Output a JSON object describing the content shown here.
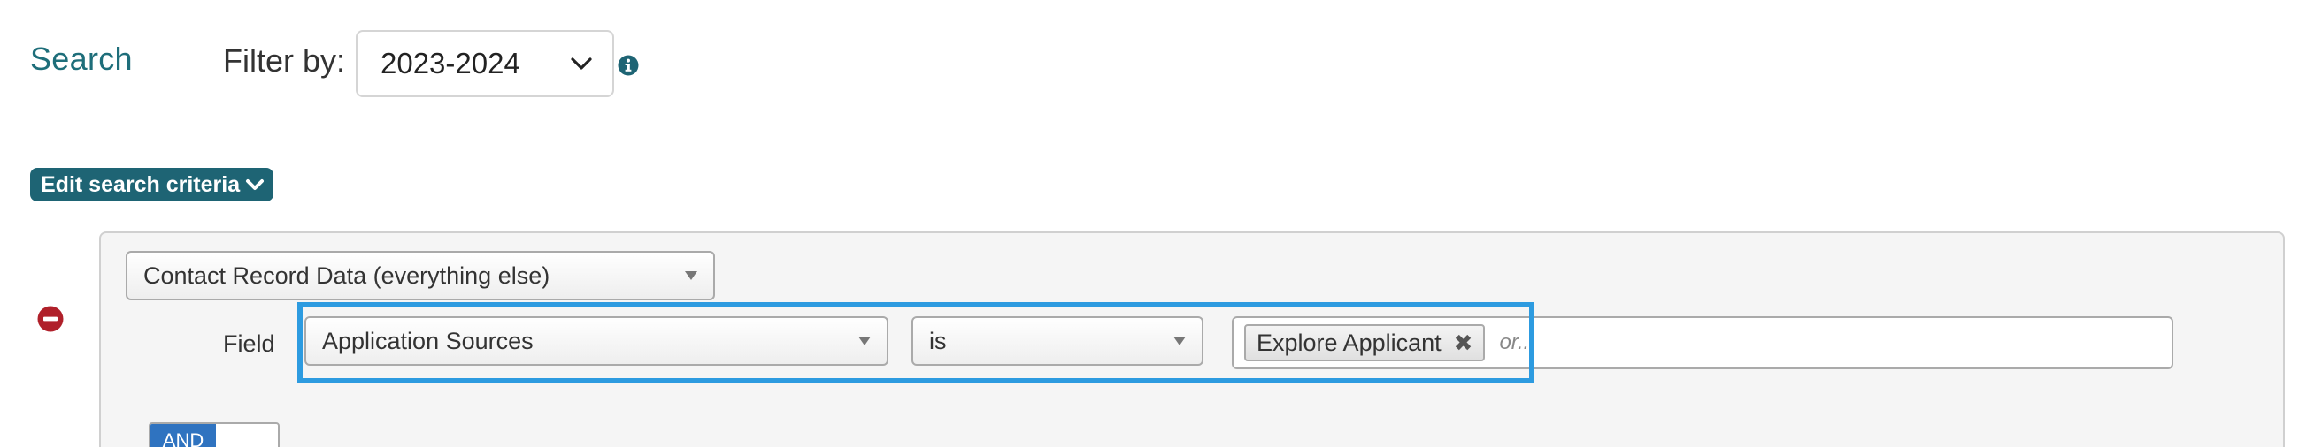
{
  "header": {
    "search_title": "Search",
    "filter_label": "Filter by:",
    "year_select": {
      "selected": "2023-2024"
    }
  },
  "edit_criteria_label": "Edit search criteria",
  "criteria": {
    "category": "Contact Record Data (everything else)",
    "field_label": "Field",
    "field": "Application Sources",
    "operator": "is",
    "values": [
      "Explore Applicant"
    ],
    "placeholder": "or...",
    "logic": {
      "and_label": "AND",
      "or_label": ""
    }
  },
  "colors": {
    "accent_teal": "#1e6474",
    "title_teal": "#1e6e7a",
    "highlight_blue": "#2d9be0",
    "remove_red": "#b0202a",
    "and_blue": "#2f73c0"
  },
  "icons": {
    "info": "info-icon",
    "remove": "remove-icon",
    "chevron": "chevron-down-icon",
    "token_remove": "close-icon"
  }
}
